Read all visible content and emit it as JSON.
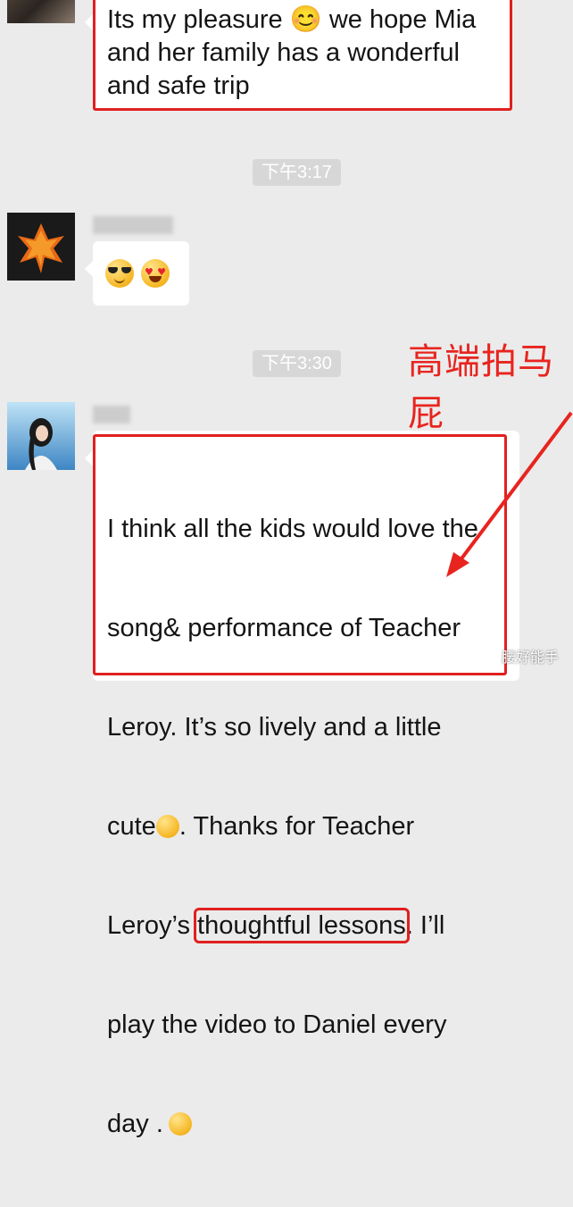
{
  "messages": [
    {
      "text": "Its my pleasure 😊 we hope Mia\nand her family has a wonderful\nand safe trip"
    },
    {
      "emoji": "😎😍"
    },
    {
      "line1": "I think all the kids would love the",
      "line2": "song& performance of Teacher",
      "line3": "Leroy. It’s so lively and a little",
      "line4a": "cute",
      "line4b": ". Thanks for Teacher",
      "line5a": "Leroy’s ",
      "line5_highlight": "thoughtful lessons",
      "line5b": ". I’ll",
      "line6": "play the video to Daniel every",
      "line7": "day ."
    }
  ],
  "timestamps": [
    "下午3:17",
    "下午3:30"
  ],
  "annotation": "高端拍马屁",
  "watermark": "腰好能手",
  "colors": {
    "highlight_red": "#e02020",
    "background": "#ebebeb"
  }
}
